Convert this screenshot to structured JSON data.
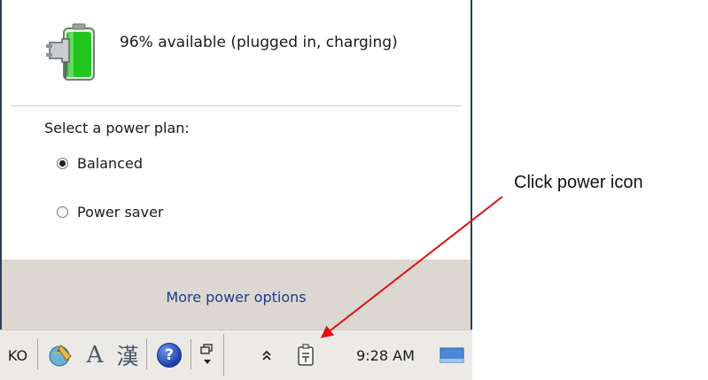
{
  "flyout": {
    "battery_status": "96% available (plugged in, charging)",
    "battery_percent": 96,
    "plan_heading": "Select a power plan:",
    "plans": [
      {
        "label": "Balanced",
        "selected": true
      },
      {
        "label": "Power saver",
        "selected": false
      }
    ],
    "more_options_link": "More power options"
  },
  "taskbar": {
    "language_indicator": "KO",
    "ime_icons": [
      "ime-brush-icon",
      "ime-a-icon",
      "ime-hanja-icon"
    ],
    "ime_a_label": "A",
    "ime_hanja_label": "漢",
    "help_label": "?",
    "clock": "9:28 AM",
    "tray_icons": [
      "restore-icon",
      "show-hidden-chevron-icon",
      "power-plug-icon",
      "show-desktop-icon"
    ]
  },
  "annotation": {
    "text": "Click power icon",
    "arrow_color": "#e01010"
  },
  "colors": {
    "battery_green": "#22c41e",
    "link_blue": "#1f3b8a",
    "footer_bg": "#dcd7d0",
    "window_border": "#2d3e55"
  }
}
